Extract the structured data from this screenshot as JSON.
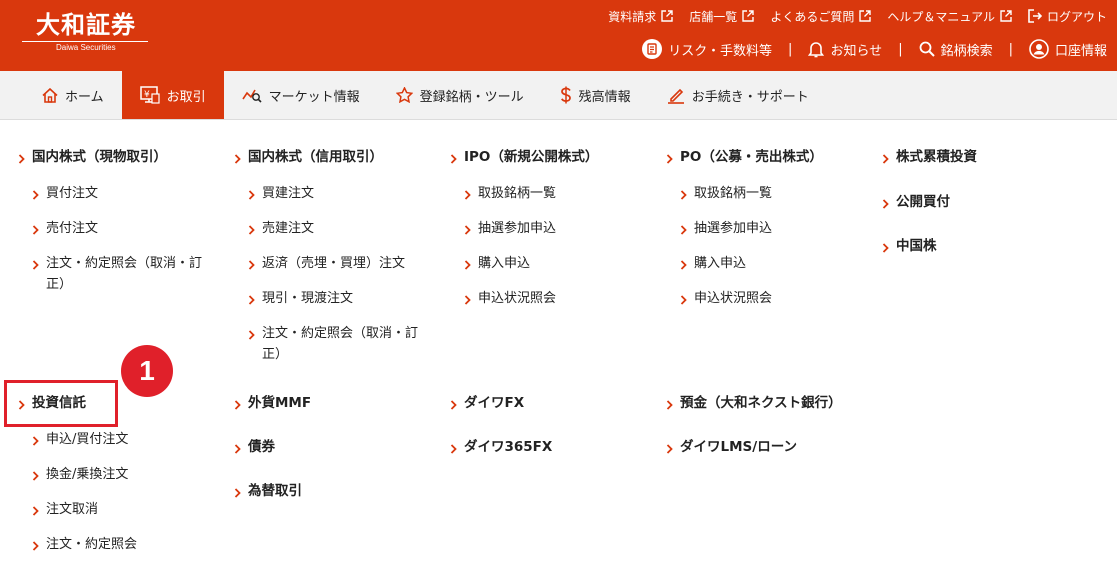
{
  "brand": {
    "name": "大和証券",
    "sub": "Daiwa Securities"
  },
  "toplinks": [
    "資料請求",
    "店舗一覧",
    "よくあるご質問",
    "ヘルプ＆マニュアル",
    "ログアウト"
  ],
  "utillinks": [
    "リスク・手数料等",
    "お知らせ",
    "銘柄検索",
    "口座情報"
  ],
  "util_separator": "|",
  "nav": [
    "ホーム",
    "お取引",
    "マーケット情報",
    "登録銘柄・ツール",
    "残高情報",
    "お手続き・サポート"
  ],
  "menu": {
    "genbutsu": {
      "title": "国内株式（現物取引）",
      "items": [
        "買付注文",
        "売付注文",
        "注文・約定照会（取消・訂",
        "正）"
      ]
    },
    "shinyo": {
      "title": "国内株式（信用取引）",
      "items": [
        "買建注文",
        "売建注文",
        "返済（売埋・買埋）注文",
        "現引・現渡注文",
        "注文・約定照会（取消・訂",
        "正）"
      ]
    },
    "ipo": {
      "title": "IPO（新規公開株式）",
      "items": [
        "取扱銘柄一覧",
        "抽選参加申込",
        "購入申込",
        "申込状況照会"
      ]
    },
    "po": {
      "title": "PO（公募・売出株式）",
      "items": [
        "取扱銘柄一覧",
        "抽選参加申込",
        "購入申込",
        "申込状況照会"
      ]
    },
    "col5": [
      "株式累積投資",
      "公開買付",
      "中国株"
    ],
    "toshin": {
      "title": "投資信託",
      "items": [
        "申込/買付注文",
        "換金/乗換注文",
        "注文取消",
        "注文・約定照会"
      ]
    },
    "col2b": [
      "外貨MMF",
      "債券",
      "為替取引"
    ],
    "col3b": [
      "ダイワFX",
      "ダイワ365FX"
    ],
    "col4b": [
      "預金（大和ネクスト銀行）",
      "ダイワLMS/ローン"
    ]
  },
  "annotation": {
    "number": "1"
  },
  "colors": {
    "brand": "#d9380d",
    "highlight": "#e0202a"
  }
}
